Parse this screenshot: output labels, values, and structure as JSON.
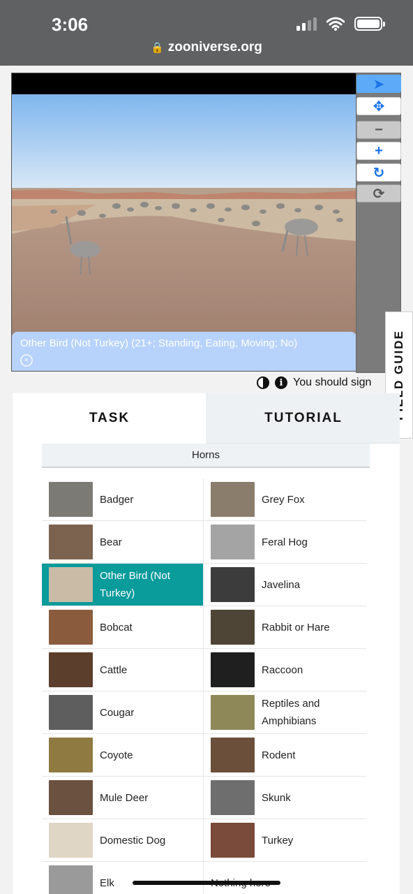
{
  "status_bar": {
    "time": "3:06",
    "url": "zooniverse.org"
  },
  "viewer": {
    "label": "Other Bird (Not Turkey) (21+; Standing, Eating, Moving; No)",
    "close_symbol": "×"
  },
  "toolbar": {
    "tools": [
      {
        "icon": "pointer-icon",
        "glyph": "➤"
      },
      {
        "icon": "move-icon",
        "glyph": "✥"
      },
      {
        "icon": "zoom-out-icon",
        "glyph": "−"
      },
      {
        "icon": "zoom-in-icon",
        "glyph": "+"
      },
      {
        "icon": "rotate-icon",
        "glyph": "↻"
      },
      {
        "icon": "reset-icon",
        "glyph": "⟳"
      }
    ]
  },
  "field_guide": {
    "label": "FIELD GUIDE"
  },
  "info_row": {
    "text": "You should sign",
    "info_glyph": "i"
  },
  "tabs": {
    "task": "TASK",
    "tutorial": "TUTORIAL"
  },
  "filter": {
    "label": "Horns"
  },
  "choices": [
    {
      "label": "Badger",
      "selected": false,
      "thumb": "#7c7a74"
    },
    {
      "label": "Grey Fox",
      "selected": false,
      "thumb": "#8a7d6c"
    },
    {
      "label": "Bear",
      "selected": false,
      "thumb": "#7b6350"
    },
    {
      "label": "Feral Hog",
      "selected": false,
      "thumb": "#a4a4a4"
    },
    {
      "label": "Other Bird (Not Turkey)",
      "selected": true,
      "thumb": "#c9bba6"
    },
    {
      "label": "Javelina",
      "selected": false,
      "thumb": "#3c3c3c"
    },
    {
      "label": "Bobcat",
      "selected": false,
      "thumb": "#8a5c3d"
    },
    {
      "label": "Rabbit or Hare",
      "selected": false,
      "thumb": "#4f4536"
    },
    {
      "label": "Cattle",
      "selected": false,
      "thumb": "#5b3e2c"
    },
    {
      "label": "Raccoon",
      "selected": false,
      "thumb": "#1f1f1f"
    },
    {
      "label": "Cougar",
      "selected": false,
      "thumb": "#5e5e5e"
    },
    {
      "label": "Reptiles and Amphibians",
      "selected": false,
      "thumb": "#8e8758"
    },
    {
      "label": "Coyote",
      "selected": false,
      "thumb": "#8f7a41"
    },
    {
      "label": "Rodent",
      "selected": false,
      "thumb": "#6b4f3a"
    },
    {
      "label": "Mule Deer",
      "selected": false,
      "thumb": "#6b5140"
    },
    {
      "label": "Skunk",
      "selected": false,
      "thumb": "#6e6e6e"
    },
    {
      "label": "Domestic Dog",
      "selected": false,
      "thumb": "#e0d6c6"
    },
    {
      "label": "Turkey",
      "selected": false,
      "thumb": "#7a4a3a"
    },
    {
      "label": "Elk",
      "selected": false,
      "thumb": "#9a9a9a"
    },
    {
      "label": "Nothing here",
      "selected": false,
      "thumb": ""
    }
  ]
}
